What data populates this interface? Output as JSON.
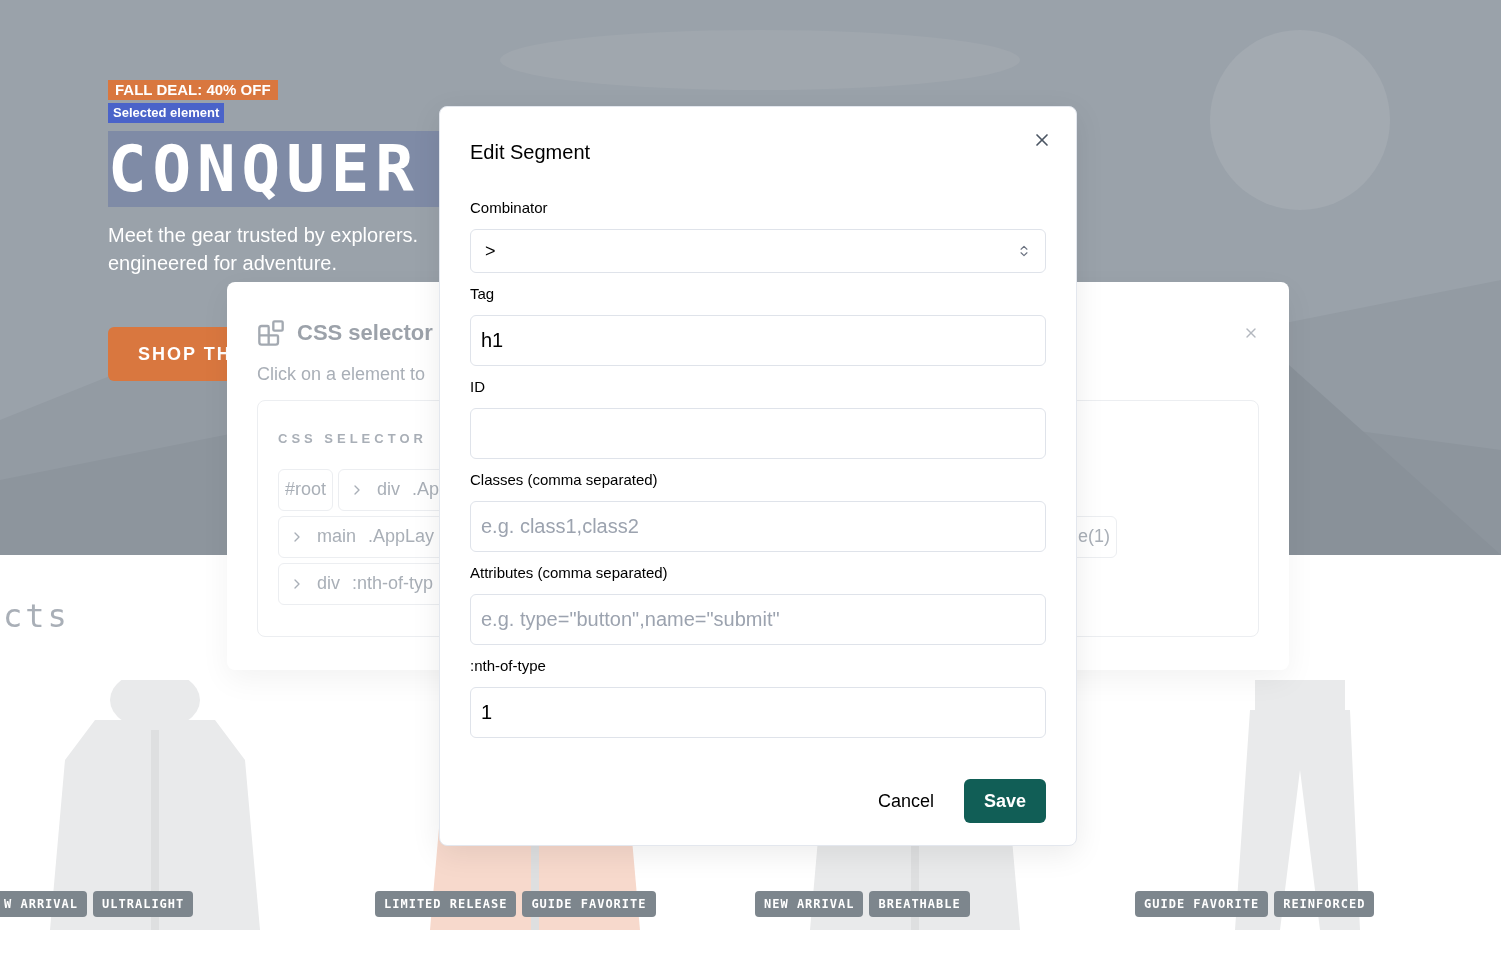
{
  "hero": {
    "badge": "FALL DEAL: 40% OFF",
    "selection_label": "Selected element",
    "heading": "CONQUER",
    "intro": [
      "Meet the gear trusted by explorers.",
      "engineered for adventure."
    ],
    "cta": "SHOP TH"
  },
  "products": {
    "heading": "cts",
    "cards": [
      {
        "kind": "picture",
        "tags": [
          "W ARRIVAL",
          "ULTRALIGHT"
        ]
      },
      {
        "kind": "picture",
        "tags": [
          "LIMITED RELEASE",
          "GUIDE FAVORITE"
        ]
      },
      {
        "kind": "picture",
        "tags": [
          "NEW ARRIVAL",
          "BREATHABLE"
        ]
      },
      {
        "kind": "picture",
        "tags": [
          "GUIDE FAVORITE",
          "REINFORCED"
        ]
      }
    ]
  },
  "selector_panel": {
    "title": "CSS selector",
    "subtitle": "Click on a element to",
    "card_label": "CSS SELECTOR",
    "segments": [
      {
        "kind": "root",
        "text": "#root"
      },
      {
        "kind": "segment",
        "tag": "div",
        "detail": ".Ap"
      },
      {
        "kind": "segment",
        "tag": "main",
        "detail": ".AppLay"
      },
      {
        "kind": "tail",
        "text": "e(1)"
      },
      {
        "kind": "segment",
        "tag": "div",
        "detail": ":nth-of-typ"
      }
    ]
  },
  "dialog": {
    "title": "Edit Segment",
    "fields": [
      {
        "label": "Combinator",
        "kind": "select",
        "value": ">"
      },
      {
        "label": "Tag",
        "kind": "text",
        "value": "h1"
      },
      {
        "label": "ID",
        "kind": "text"
      },
      {
        "label": "Classes (comma separated)",
        "kind": "text",
        "placeholder": "e.g. class1,class2"
      },
      {
        "label": "Attributes (comma separated)",
        "kind": "text",
        "placeholder": "e.g. type=\"button\",name=\"submit\""
      },
      {
        "label": ":nth-of-type",
        "kind": "text",
        "value": "1"
      }
    ],
    "buttons": [
      {
        "label": "Cancel",
        "kind": "secondary"
      },
      {
        "label": "Save",
        "kind": "primary"
      }
    ]
  }
}
